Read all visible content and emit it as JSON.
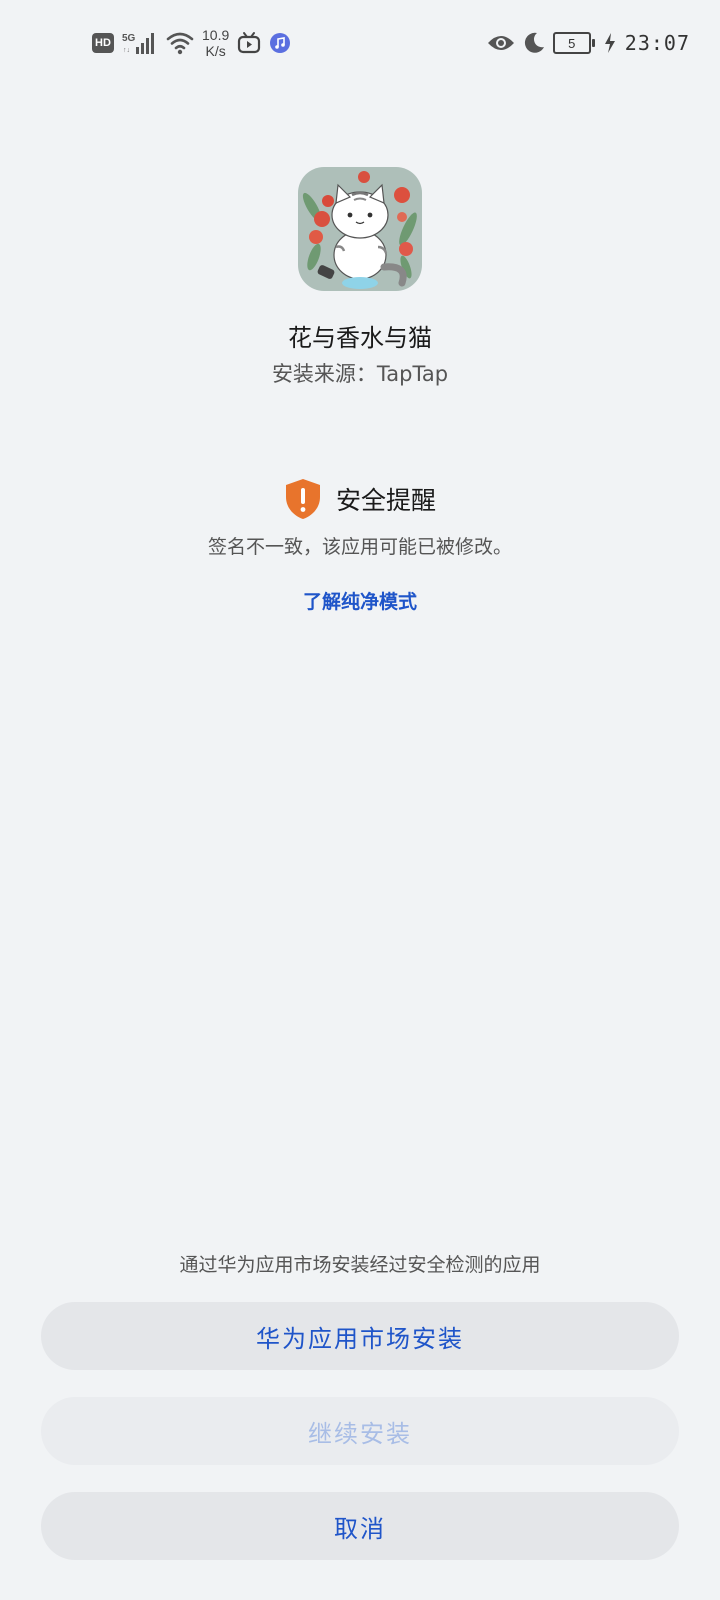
{
  "status_bar": {
    "hd": "HD",
    "network": "5G",
    "net_speed_value": "10.9",
    "net_speed_unit": "K/s",
    "battery_level": "5",
    "time": "23:07",
    "icons": [
      "hd-badge-icon",
      "signal-5g-icon",
      "wifi-icon",
      "tv-app-icon",
      "music-app-icon",
      "eye-icon",
      "moon-icon",
      "battery-icon",
      "charging-bolt-icon"
    ]
  },
  "app": {
    "name": "花与香水与猫",
    "source": "安装来源：TapTap",
    "icon": "cat-app-icon"
  },
  "security": {
    "title": "安全提醒",
    "message": "签名不一致，该应用可能已被修改。",
    "learn_more": "了解纯净模式",
    "icon": "shield-warning-icon",
    "accent": "#e8742c"
  },
  "footer": {
    "hint": "通过华为应用市场安装经过安全检测的应用",
    "market_install_label": "华为应用市场安装",
    "continue_install_label": "继续安装",
    "cancel_label": "取消"
  },
  "colors": {
    "background": "#f1f3f5",
    "link_blue": "#1f55c9",
    "disabled_blue": "#a8bde6",
    "button_bg": "#e4e6e9"
  }
}
